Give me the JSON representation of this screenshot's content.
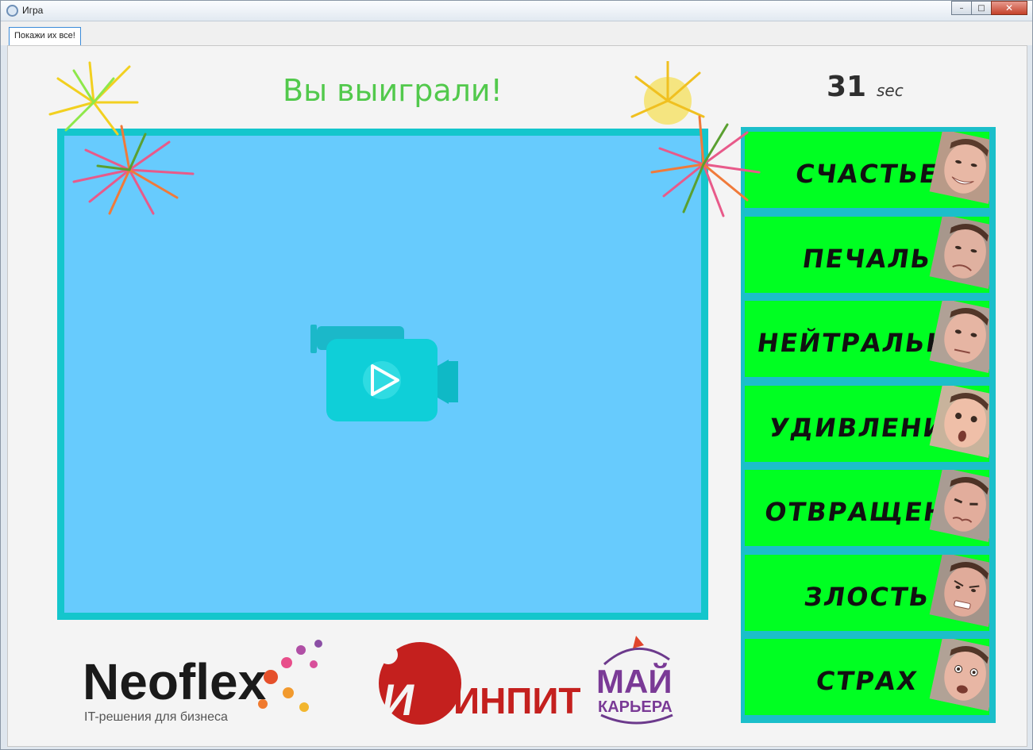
{
  "window": {
    "title": "Игра",
    "controls": {
      "minimize": "–",
      "maximize": "□",
      "close": "✕"
    }
  },
  "tabs": [
    {
      "label": "Покажи их все!"
    }
  ],
  "game": {
    "status": "Вы выиграли!",
    "timer_value": "31",
    "timer_unit": "sec"
  },
  "emotions": [
    {
      "label": "СЧАСТЬЕ"
    },
    {
      "label": "ПЕЧАЛЬ"
    },
    {
      "label": "НЕЙТРАЛЬНЫ"
    },
    {
      "label": "УДИВЛЕНИЕ"
    },
    {
      "label": "ОТВРАЩЕНИ"
    },
    {
      "label": "ЗЛОСТЬ"
    },
    {
      "label": "СТРАХ"
    }
  ],
  "logos": {
    "neoflex": {
      "name": "Neoflex",
      "tagline": "IT-решения для бизнеса"
    },
    "inpit": {
      "name": "ИНПИТ"
    },
    "mai": {
      "line1": "МАЙ",
      "line2": "КАРЬЕРА"
    }
  },
  "colors": {
    "status": "#52c94c",
    "video_bg": "#67cbfd",
    "frame": "#14c6cc",
    "emotion_bg": "#00ff22"
  },
  "icons": {
    "video": "video-camera-play-icon",
    "fireworks": "firework-icon"
  }
}
